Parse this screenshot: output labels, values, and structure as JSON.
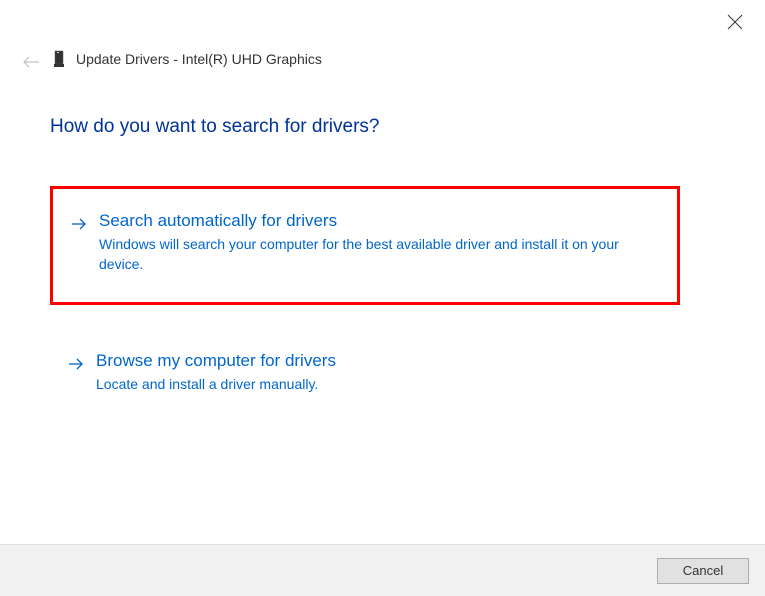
{
  "window": {
    "title": "Update Drivers - Intel(R) UHD Graphics"
  },
  "heading": "How do you want to search for drivers?",
  "options": [
    {
      "title": "Search automatically for drivers",
      "description": "Windows will search your computer for the best available driver and install it on your device."
    },
    {
      "title": "Browse my computer for drivers",
      "description": "Locate and install a driver manually."
    }
  ],
  "footer": {
    "cancel_label": "Cancel"
  }
}
